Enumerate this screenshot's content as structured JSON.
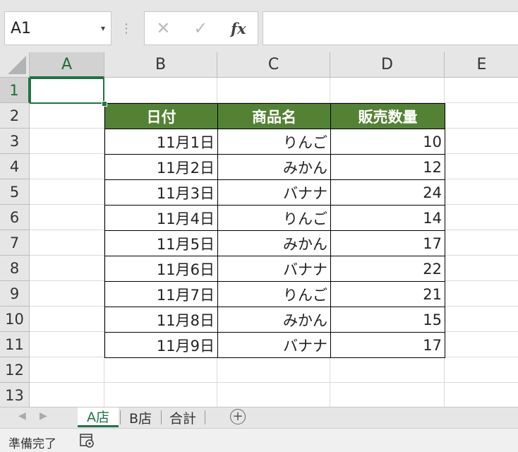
{
  "formula_bar": {
    "name_box": "A1",
    "cancel_glyph": "✕",
    "enter_glyph": "✓",
    "fx_label": "fx",
    "formula_value": ""
  },
  "columns": [
    "A",
    "B",
    "C",
    "D",
    "E"
  ],
  "rows": [
    "1",
    "2",
    "3",
    "4",
    "5",
    "6",
    "7",
    "8",
    "9",
    "10",
    "11",
    "12",
    "13"
  ],
  "table": {
    "headers": [
      "日付",
      "商品名",
      "販売数量"
    ],
    "header_color": "#548235",
    "rows": [
      [
        "11月1日",
        "りんご",
        "10"
      ],
      [
        "11月2日",
        "みかん",
        "12"
      ],
      [
        "11月3日",
        "バナナ",
        "24"
      ],
      [
        "11月4日",
        "りんご",
        "14"
      ],
      [
        "11月5日",
        "みかん",
        "17"
      ],
      [
        "11月6日",
        "バナナ",
        "22"
      ],
      [
        "11月7日",
        "りんご",
        "21"
      ],
      [
        "11月8日",
        "みかん",
        "15"
      ],
      [
        "11月9日",
        "バナナ",
        "17"
      ]
    ]
  },
  "selected_cell": "A1",
  "sheet_tabs": [
    {
      "label": "A店",
      "active": true
    },
    {
      "label": "B店",
      "active": false
    },
    {
      "label": "合計",
      "active": false
    }
  ],
  "add_sheet_glyph": "+",
  "status": {
    "ready_text": "準備完了",
    "icon": "accessibility-macro-icon"
  },
  "accent_color": "#217346"
}
